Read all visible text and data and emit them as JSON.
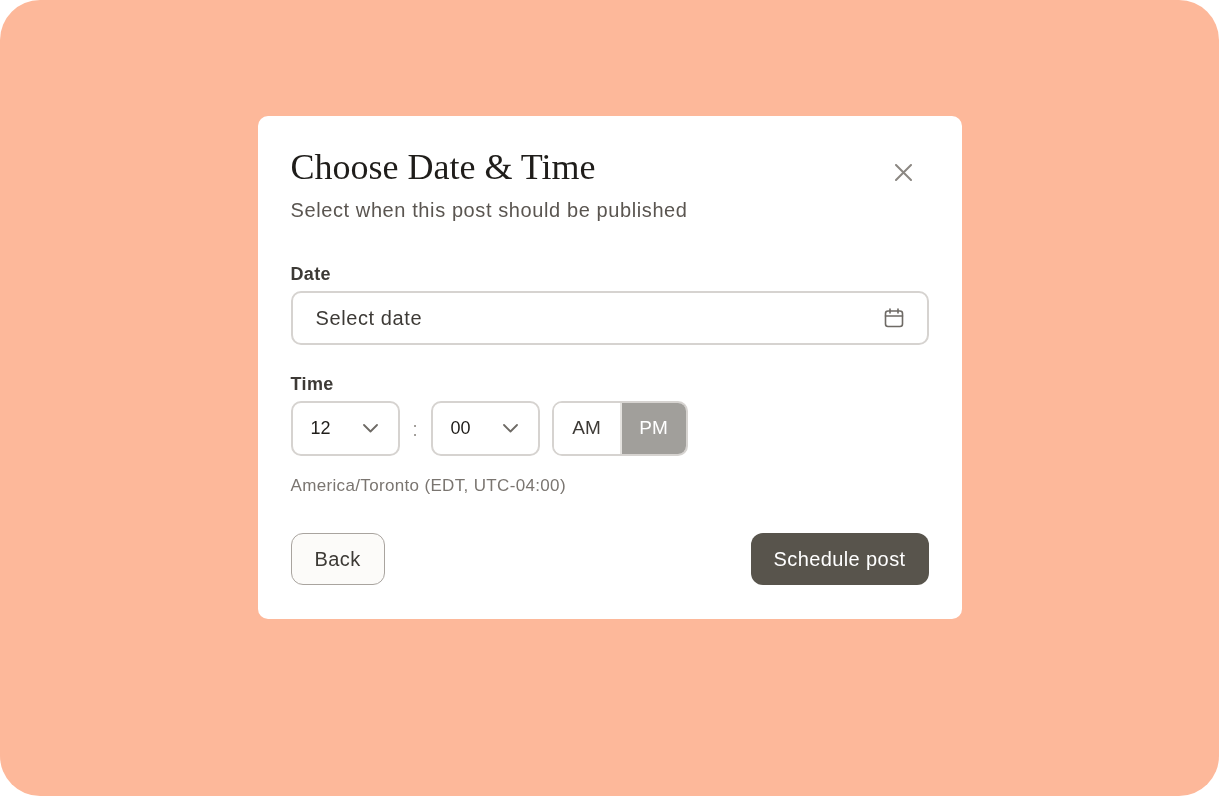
{
  "dialog": {
    "title": "Choose Date & Time",
    "subtitle": "Select when this post should be published",
    "date_field": {
      "label": "Date",
      "placeholder": "Select date"
    },
    "time": {
      "label": "Time",
      "hour": {
        "value": "12"
      },
      "separator": ":",
      "minute": {
        "value": "00"
      },
      "period_options": [
        {
          "label": "AM",
          "selected": false
        },
        {
          "label": "PM",
          "selected": true
        }
      ]
    },
    "timezone": "America/Toronto (EDT, UTC-04:00)",
    "buttons": [
      {
        "label": "Back",
        "kind": "secondary"
      },
      {
        "label": "Schedule post",
        "kind": "primary"
      }
    ]
  }
}
